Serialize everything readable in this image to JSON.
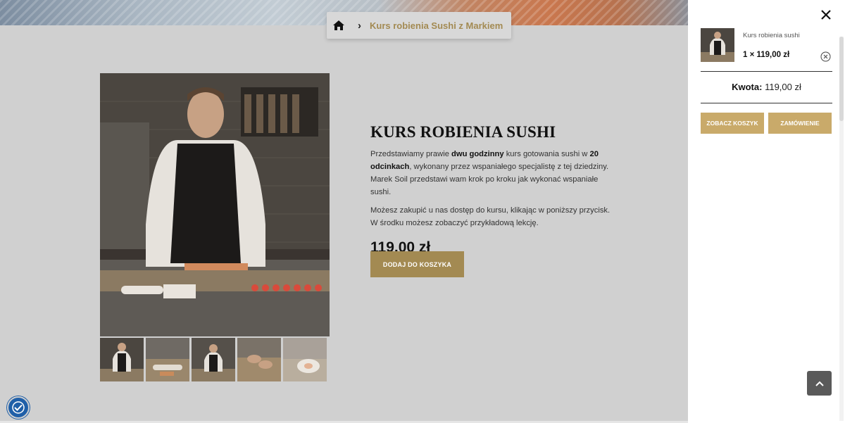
{
  "breadcrumb": {
    "home_icon": "home-icon",
    "separator": "›",
    "current": "Kurs robienia Sushi z Markiem"
  },
  "product": {
    "title": "KURS ROBIENIA SUSHI",
    "desc1_part1": "Przedstawiamy prawie ",
    "desc1_bold1": "dwu godzinny",
    "desc1_part2": " kurs gotowania sushi w ",
    "desc1_bold2": "20 odcinkach",
    "desc1_part3": ", wykonany przez wspaniałego specjalistę z tej dziedziny. Marek Soil przedstawi wam krok po kroku jak wykonać wspaniałe sushi.",
    "desc2": "Możesz zakupić u nas dostęp do kursu, klikając w poniższy przycisk. W środku możesz zobaczyć przykładową lekcję.",
    "price": "119,00 zł",
    "add_to_cart": "DODAJ DO KOSZYKA"
  },
  "gallery": {
    "thumbnails": [
      "thumb-chef",
      "thumb-rolls",
      "thumb-chef-wide",
      "thumb-hands",
      "thumb-plate"
    ]
  },
  "cart": {
    "item_name": "Kurs robienia sushi",
    "item_qty_price": "1 × 119,00 zł",
    "total_label": "Kwota:",
    "total_value": "119,00 zł",
    "view_cart": "ZOBACZ KOSZYK",
    "checkout": "ZAMÓWIENIE"
  },
  "colors": {
    "accent": "#a38a52",
    "drawer_button": "#c9aa6a",
    "accessibility": "#1f5fa8"
  }
}
